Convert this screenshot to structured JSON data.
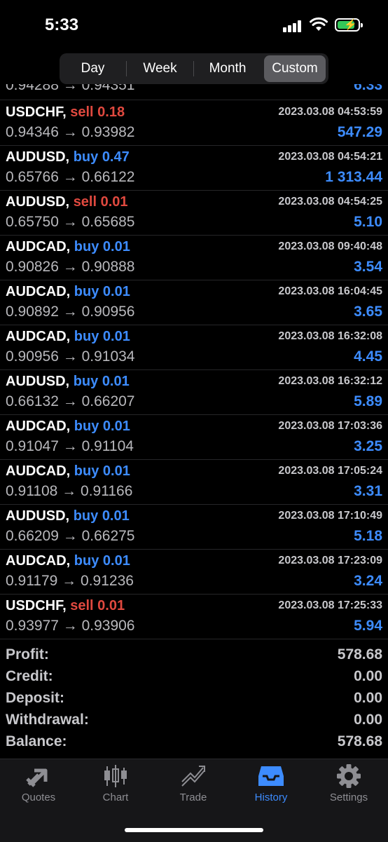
{
  "status": {
    "time": "5:33"
  },
  "tabs": [
    "Day",
    "Week",
    "Month",
    "Custom"
  ],
  "active_tab": "Custom",
  "trades": [
    {
      "symbol": "USDCHF,",
      "side": "sell",
      "volume": "0.18",
      "time": "2023.03.08 04:53:59",
      "prices": "0.94346 → 0.93982",
      "profit": "547.29"
    },
    {
      "symbol": "AUDUSD,",
      "side": "buy",
      "volume": "0.47",
      "time": "2023.03.08 04:54:21",
      "prices": "0.65766 → 0.66122",
      "profit": "1 313.44"
    },
    {
      "symbol": "AUDUSD,",
      "side": "sell",
      "volume": "0.01",
      "time": "2023.03.08 04:54:25",
      "prices": "0.65750 → 0.65685",
      "profit": "5.10"
    },
    {
      "symbol": "AUDCAD,",
      "side": "buy",
      "volume": "0.01",
      "time": "2023.03.08 09:40:48",
      "prices": "0.90826 → 0.90888",
      "profit": "3.54"
    },
    {
      "symbol": "AUDCAD,",
      "side": "buy",
      "volume": "0.01",
      "time": "2023.03.08 16:04:45",
      "prices": "0.90892 → 0.90956",
      "profit": "3.65"
    },
    {
      "symbol": "AUDCAD,",
      "side": "buy",
      "volume": "0.01",
      "time": "2023.03.08 16:32:08",
      "prices": "0.90956 → 0.91034",
      "profit": "4.45"
    },
    {
      "symbol": "AUDUSD,",
      "side": "buy",
      "volume": "0.01",
      "time": "2023.03.08 16:32:12",
      "prices": "0.66132 → 0.66207",
      "profit": "5.89"
    },
    {
      "symbol": "AUDCAD,",
      "side": "buy",
      "volume": "0.01",
      "time": "2023.03.08 17:03:36",
      "prices": "0.91047 → 0.91104",
      "profit": "3.25"
    },
    {
      "symbol": "AUDCAD,",
      "side": "buy",
      "volume": "0.01",
      "time": "2023.03.08 17:05:24",
      "prices": "0.91108 → 0.91166",
      "profit": "3.31"
    },
    {
      "symbol": "AUDUSD,",
      "side": "buy",
      "volume": "0.01",
      "time": "2023.03.08 17:10:49",
      "prices": "0.66209 → 0.66275",
      "profit": "5.18"
    },
    {
      "symbol": "AUDCAD,",
      "side": "buy",
      "volume": "0.01",
      "time": "2023.03.08 17:23:09",
      "prices": "0.91179 → 0.91236",
      "profit": "3.24"
    },
    {
      "symbol": "USDCHF,",
      "side": "sell",
      "volume": "0.01",
      "time": "2023.03.08 17:25:33",
      "prices": "0.93977 → 0.93906",
      "profit": "5.94"
    }
  ],
  "summary": [
    {
      "label": "Profit:",
      "value": "578.68"
    },
    {
      "label": "Credit:",
      "value": "0.00"
    },
    {
      "label": "Deposit:",
      "value": "0.00"
    },
    {
      "label": "Withdrawal:",
      "value": "0.00"
    },
    {
      "label": "Balance:",
      "value": "578.68"
    }
  ],
  "nav": [
    {
      "label": "Quotes",
      "icon": "quotes-icon"
    },
    {
      "label": "Chart",
      "icon": "chart-icon"
    },
    {
      "label": "Trade",
      "icon": "trade-icon"
    },
    {
      "label": "History",
      "icon": "history-icon"
    },
    {
      "label": "Settings",
      "icon": "gear-icon"
    }
  ],
  "active_nav": "History",
  "colors": {
    "buy": "#3d8cff",
    "sell": "#e0493f",
    "profit": "#3d8cff",
    "background": "#000000"
  }
}
